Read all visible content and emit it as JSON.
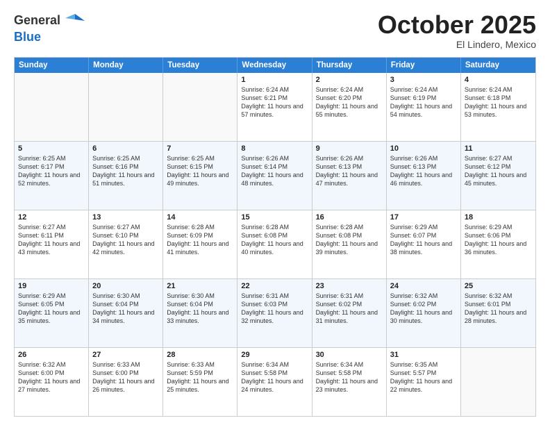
{
  "header": {
    "logo_line1": "General",
    "logo_line2": "Blue",
    "month": "October 2025",
    "location": "El Lindero, Mexico"
  },
  "weekdays": [
    "Sunday",
    "Monday",
    "Tuesday",
    "Wednesday",
    "Thursday",
    "Friday",
    "Saturday"
  ],
  "rows": [
    [
      {
        "day": "",
        "info": ""
      },
      {
        "day": "",
        "info": ""
      },
      {
        "day": "",
        "info": ""
      },
      {
        "day": "1",
        "info": "Sunrise: 6:24 AM\nSunset: 6:21 PM\nDaylight: 11 hours and 57 minutes."
      },
      {
        "day": "2",
        "info": "Sunrise: 6:24 AM\nSunset: 6:20 PM\nDaylight: 11 hours and 55 minutes."
      },
      {
        "day": "3",
        "info": "Sunrise: 6:24 AM\nSunset: 6:19 PM\nDaylight: 11 hours and 54 minutes."
      },
      {
        "day": "4",
        "info": "Sunrise: 6:24 AM\nSunset: 6:18 PM\nDaylight: 11 hours and 53 minutes."
      }
    ],
    [
      {
        "day": "5",
        "info": "Sunrise: 6:25 AM\nSunset: 6:17 PM\nDaylight: 11 hours and 52 minutes."
      },
      {
        "day": "6",
        "info": "Sunrise: 6:25 AM\nSunset: 6:16 PM\nDaylight: 11 hours and 51 minutes."
      },
      {
        "day": "7",
        "info": "Sunrise: 6:25 AM\nSunset: 6:15 PM\nDaylight: 11 hours and 49 minutes."
      },
      {
        "day": "8",
        "info": "Sunrise: 6:26 AM\nSunset: 6:14 PM\nDaylight: 11 hours and 48 minutes."
      },
      {
        "day": "9",
        "info": "Sunrise: 6:26 AM\nSunset: 6:13 PM\nDaylight: 11 hours and 47 minutes."
      },
      {
        "day": "10",
        "info": "Sunrise: 6:26 AM\nSunset: 6:13 PM\nDaylight: 11 hours and 46 minutes."
      },
      {
        "day": "11",
        "info": "Sunrise: 6:27 AM\nSunset: 6:12 PM\nDaylight: 11 hours and 45 minutes."
      }
    ],
    [
      {
        "day": "12",
        "info": "Sunrise: 6:27 AM\nSunset: 6:11 PM\nDaylight: 11 hours and 43 minutes."
      },
      {
        "day": "13",
        "info": "Sunrise: 6:27 AM\nSunset: 6:10 PM\nDaylight: 11 hours and 42 minutes."
      },
      {
        "day": "14",
        "info": "Sunrise: 6:28 AM\nSunset: 6:09 PM\nDaylight: 11 hours and 41 minutes."
      },
      {
        "day": "15",
        "info": "Sunrise: 6:28 AM\nSunset: 6:08 PM\nDaylight: 11 hours and 40 minutes."
      },
      {
        "day": "16",
        "info": "Sunrise: 6:28 AM\nSunset: 6:08 PM\nDaylight: 11 hours and 39 minutes."
      },
      {
        "day": "17",
        "info": "Sunrise: 6:29 AM\nSunset: 6:07 PM\nDaylight: 11 hours and 38 minutes."
      },
      {
        "day": "18",
        "info": "Sunrise: 6:29 AM\nSunset: 6:06 PM\nDaylight: 11 hours and 36 minutes."
      }
    ],
    [
      {
        "day": "19",
        "info": "Sunrise: 6:29 AM\nSunset: 6:05 PM\nDaylight: 11 hours and 35 minutes."
      },
      {
        "day": "20",
        "info": "Sunrise: 6:30 AM\nSunset: 6:04 PM\nDaylight: 11 hours and 34 minutes."
      },
      {
        "day": "21",
        "info": "Sunrise: 6:30 AM\nSunset: 6:04 PM\nDaylight: 11 hours and 33 minutes."
      },
      {
        "day": "22",
        "info": "Sunrise: 6:31 AM\nSunset: 6:03 PM\nDaylight: 11 hours and 32 minutes."
      },
      {
        "day": "23",
        "info": "Sunrise: 6:31 AM\nSunset: 6:02 PM\nDaylight: 11 hours and 31 minutes."
      },
      {
        "day": "24",
        "info": "Sunrise: 6:32 AM\nSunset: 6:02 PM\nDaylight: 11 hours and 30 minutes."
      },
      {
        "day": "25",
        "info": "Sunrise: 6:32 AM\nSunset: 6:01 PM\nDaylight: 11 hours and 28 minutes."
      }
    ],
    [
      {
        "day": "26",
        "info": "Sunrise: 6:32 AM\nSunset: 6:00 PM\nDaylight: 11 hours and 27 minutes."
      },
      {
        "day": "27",
        "info": "Sunrise: 6:33 AM\nSunset: 6:00 PM\nDaylight: 11 hours and 26 minutes."
      },
      {
        "day": "28",
        "info": "Sunrise: 6:33 AM\nSunset: 5:59 PM\nDaylight: 11 hours and 25 minutes."
      },
      {
        "day": "29",
        "info": "Sunrise: 6:34 AM\nSunset: 5:58 PM\nDaylight: 11 hours and 24 minutes."
      },
      {
        "day": "30",
        "info": "Sunrise: 6:34 AM\nSunset: 5:58 PM\nDaylight: 11 hours and 23 minutes."
      },
      {
        "day": "31",
        "info": "Sunrise: 6:35 AM\nSunset: 5:57 PM\nDaylight: 11 hours and 22 minutes."
      },
      {
        "day": "",
        "info": ""
      }
    ]
  ]
}
